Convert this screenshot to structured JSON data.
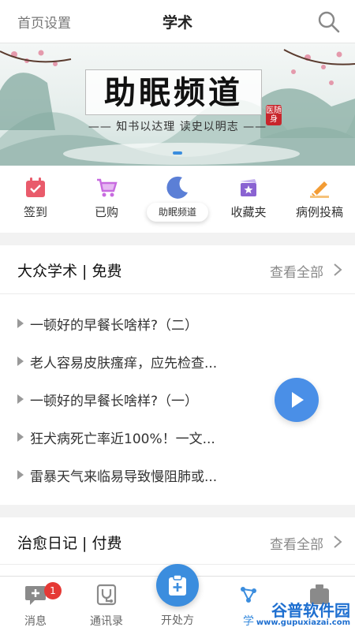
{
  "header": {
    "home_settings": "首页设置",
    "title": "学术",
    "search_icon": "search-icon"
  },
  "banner": {
    "headline": "助眠频道",
    "seal": "医随身",
    "motto": "—— 知书以达理  读史以明志 ——",
    "active_slide_indicator": true
  },
  "quick_menu": [
    {
      "label": "签到",
      "icon": "calendar-icon",
      "color": "#e95b6b"
    },
    {
      "label": "已购",
      "icon": "cart-icon",
      "color": "#c86be0"
    },
    {
      "label": "助眠频道",
      "icon": "moon-icon",
      "color": "#5b7fd6"
    },
    {
      "label": "收藏夹",
      "icon": "folder-star-icon",
      "color": "#8a63d2"
    },
    {
      "label": "病例投稿",
      "icon": "edit-icon",
      "color": "#f39c34"
    }
  ],
  "sections": {
    "public": {
      "title": "大众学术 | 免费",
      "more": "查看全部",
      "items": [
        "一顿好的早餐长啥样?（二）",
        "老人容易皮肤瘙痒，应先检查...",
        "一顿好的早餐长啥样?（一）",
        "狂犬病死亡率近100%！一文...",
        "雷暴天气来临易导致慢阻肺或..."
      ]
    },
    "diary": {
      "title": "治愈日记 | 付费",
      "more": "查看全部"
    }
  },
  "bottom_nav": {
    "messages": {
      "label": "消息",
      "badge": "1"
    },
    "contacts": {
      "label": "通讯录"
    },
    "prescribe": {
      "label": "开处方"
    },
    "academic": {
      "label": "学"
    },
    "fifth": {
      "label": ""
    }
  },
  "watermark": {
    "brand": "谷普软件园",
    "url": "www.gupuxiazai.com"
  },
  "colors": {
    "accent": "#3b8dde",
    "badge": "#e53935",
    "seal": "#c8262c"
  }
}
